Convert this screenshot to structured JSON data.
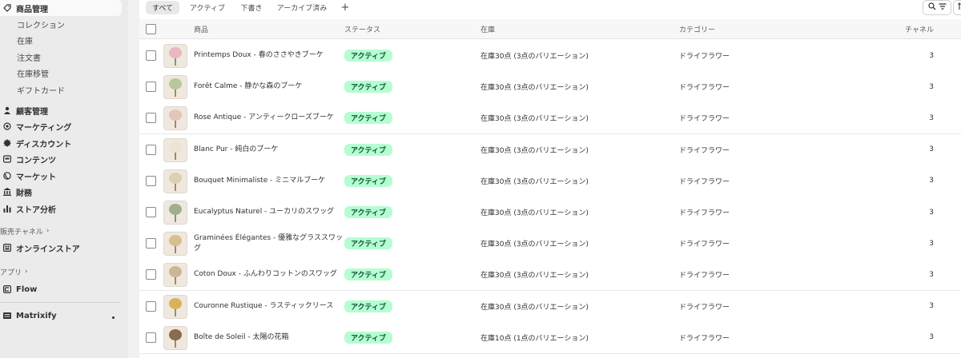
{
  "colors": {
    "badge_bg": "#b4fed2",
    "badge_text": "#0c5132",
    "sidebar_bg": "#ebebeb",
    "main_bg": "#ffffff"
  },
  "sidebar": {
    "products_label": "商品管理",
    "product_subitems": [
      "コレクション",
      "在庫",
      "注文書",
      "在庫移管",
      "ギフトカード"
    ],
    "items": [
      {
        "label": "顧客管理",
        "icon": "person-icon"
      },
      {
        "label": "マーケティング",
        "icon": "target-icon"
      },
      {
        "label": "ディスカウント",
        "icon": "discount-icon"
      },
      {
        "label": "コンテンツ",
        "icon": "content-icon"
      },
      {
        "label": "マーケット",
        "icon": "globe-icon"
      },
      {
        "label": "財務",
        "icon": "bank-icon"
      },
      {
        "label": "ストア分析",
        "icon": "bar-chart-icon"
      }
    ],
    "sales_channels_label": "販売チャネル",
    "online_store_label": "オンラインストア",
    "apps_label": "アプリ",
    "flow_label": "Flow",
    "matrixify_label": "Matrixify"
  },
  "tabs": [
    "すべて",
    "アクティブ",
    "下書き",
    "アーカイブ済み"
  ],
  "add_tab_label": "+",
  "table": {
    "headers": {
      "product": "商品",
      "status": "ステータス",
      "inventory": "在庫",
      "category": "カテゴリー",
      "channels": "チャネル"
    },
    "rows": [
      {
        "name": "Printemps Doux - 春のささやきブーケ",
        "status": "アクティブ",
        "inventory": "在庫30点 (3点のバリエーション)",
        "category": "ドライフラワー",
        "channels": "3",
        "thumb_color": "#e8b9c3"
      },
      {
        "name": "Forêt Calme - 静かな森のブーケ",
        "status": "アクティブ",
        "inventory": "在庫30点 (3点のバリエーション)",
        "category": "ドライフラワー",
        "channels": "3",
        "thumb_color": "#b9c89a"
      },
      {
        "name": "Rose Antique - アンティークローズブーケ",
        "status": "アクティブ",
        "inventory": "在庫30点 (3点のバリエーション)",
        "category": "ドライフラワー",
        "channels": "3",
        "thumb_color": "#e2c6b8"
      },
      {
        "name": "Blanc Pur - 純白のブーケ",
        "status": "アクティブ",
        "inventory": "在庫30点 (3点のバリエーション)",
        "category": "ドライフラワー",
        "channels": "3",
        "thumb_color": "#ede3d2"
      },
      {
        "name": "Bouquet Minimaliste - ミニマルブーケ",
        "status": "アクティブ",
        "inventory": "在庫30点 (3点のバリエーション)",
        "category": "ドライフラワー",
        "channels": "3",
        "thumb_color": "#dccfb4"
      },
      {
        "name": "Eucalyptus Naturel - ユーカリのスワッグ",
        "status": "アクティブ",
        "inventory": "在庫30点 (3点のバリエーション)",
        "category": "ドライフラワー",
        "channels": "3",
        "thumb_color": "#9fb08f"
      },
      {
        "name": "Graminées Élégantes - 優雅なグラススワッグ",
        "status": "アクティブ",
        "inventory": "在庫30点 (3点のバリエーション)",
        "category": "ドライフラワー",
        "channels": "3",
        "thumb_color": "#d8bf8e"
      },
      {
        "name": "Coton Doux - ふんわりコットンのスワッグ",
        "status": "アクティブ",
        "inventory": "在庫30点 (3点のバリエーション)",
        "category": "ドライフラワー",
        "channels": "3",
        "thumb_color": "#c9b896"
      },
      {
        "name": "Couronne Rustique - ラスティックリース",
        "status": "アクティブ",
        "inventory": "在庫30点 (3点のバリエーション)",
        "category": "ドライフラワー",
        "channels": "3",
        "thumb_color": "#d9b35a"
      },
      {
        "name": "Boîte de Soleil - 太陽の花箱",
        "status": "アクティブ",
        "inventory": "在庫10点 (1点のバリエーション)",
        "category": "ドライフラワー",
        "channels": "3",
        "thumb_color": "#8a6b4a"
      }
    ]
  }
}
